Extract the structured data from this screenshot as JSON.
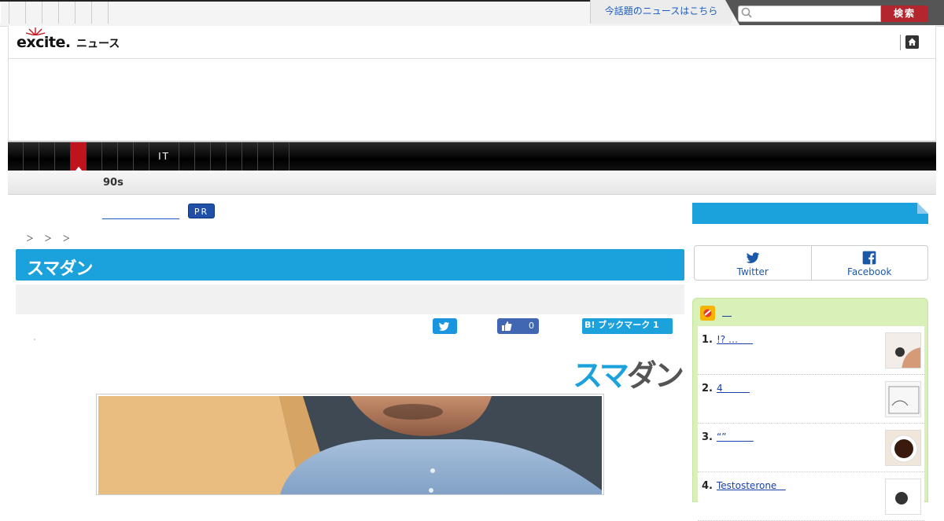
{
  "header": {
    "hot_news": "今話題のニュースはこちら",
    "search_placeholder": "",
    "search_button": "検索",
    "logo_text": "excite.",
    "logo_sub": "ニュース"
  },
  "nav": {
    "it_label": "IT",
    "sub_item": "90s"
  },
  "article": {
    "pr_badge": "PR",
    "breadcrumb": "＞ ＞ ＞",
    "brand": "スマダン",
    "like_count": "0",
    "hatena_label": "B! ブックマーク 1",
    "tiny_mark": "'",
    "brand_large_a": "スマ",
    "brand_large_b": "ダン"
  },
  "sidebar": {
    "share": [
      {
        "label": "Twitter",
        "icon": "twitter-icon"
      },
      {
        "label": "Facebook",
        "icon": "facebook-icon"
      }
    ],
    "ranking": [
      {
        "num": "1.",
        "title": "!? …     "
      },
      {
        "num": "2.",
        "title": "4         "
      },
      {
        "num": "3.",
        "title": "“”         "
      },
      {
        "num": "4.",
        "title": "Testosterone   "
      }
    ]
  },
  "colors": {
    "brand_blue": "#1ba1dc",
    "search_red": "#b3262d",
    "nav_active": "#c0141c",
    "ranking_bg": "#d9f0b8"
  }
}
